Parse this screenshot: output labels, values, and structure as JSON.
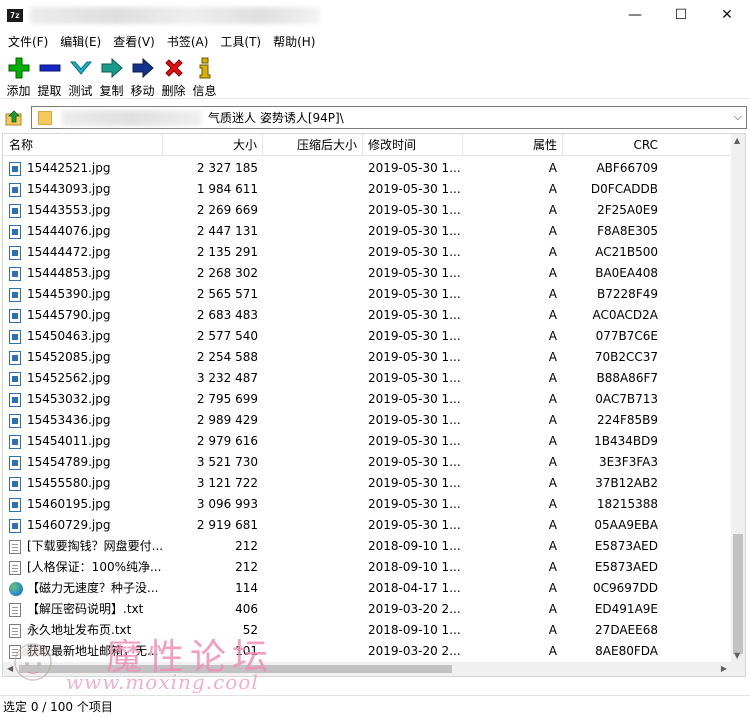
{
  "app": {
    "icon_text": "7z"
  },
  "window": {
    "minimize": "—",
    "maximize": "☐",
    "close": "✕"
  },
  "menu": [
    "文件(F)",
    "编辑(E)",
    "查看(V)",
    "书签(A)",
    "工具(T)",
    "帮助(H)"
  ],
  "toolbar": [
    {
      "label": "添加",
      "icon": "add-icon",
      "color": "#00b000"
    },
    {
      "label": "提取",
      "icon": "extract-icon",
      "color": "#1428c8"
    },
    {
      "label": "测试",
      "icon": "test-icon",
      "color": "#1ab4c8"
    },
    {
      "label": "复制",
      "icon": "copy-icon",
      "color": "#1a9c8c"
    },
    {
      "label": "移动",
      "icon": "move-icon",
      "color": "#14328c"
    },
    {
      "label": "删除",
      "icon": "delete-icon",
      "color": "#e01010"
    },
    {
      "label": "信息",
      "icon": "info-icon",
      "color": "#d8b000"
    }
  ],
  "address": {
    "path_visible": "气质迷人 姿势诱人[94P]\\"
  },
  "columns": {
    "name": "名称",
    "size": "大小",
    "packed": "压缩后大小",
    "mtime": "修改时间",
    "attr": "属性",
    "crc": "CRC"
  },
  "files": [
    {
      "name": "15442521.jpg",
      "size": "2 327 185",
      "packed": "",
      "mtime": "2019-05-30 1...",
      "attr": "A",
      "crc": "ABF66709",
      "type": "image"
    },
    {
      "name": "15443093.jpg",
      "size": "1 984 611",
      "packed": "",
      "mtime": "2019-05-30 1...",
      "attr": "A",
      "crc": "D0FCADDB",
      "type": "image"
    },
    {
      "name": "15443553.jpg",
      "size": "2 269 669",
      "packed": "",
      "mtime": "2019-05-30 1...",
      "attr": "A",
      "crc": "2F25A0E9",
      "type": "image"
    },
    {
      "name": "15444076.jpg",
      "size": "2 447 131",
      "packed": "",
      "mtime": "2019-05-30 1...",
      "attr": "A",
      "crc": "F8A8E305",
      "type": "image"
    },
    {
      "name": "15444472.jpg",
      "size": "2 135 291",
      "packed": "",
      "mtime": "2019-05-30 1...",
      "attr": "A",
      "crc": "AC21B500",
      "type": "image"
    },
    {
      "name": "15444853.jpg",
      "size": "2 268 302",
      "packed": "",
      "mtime": "2019-05-30 1...",
      "attr": "A",
      "crc": "BA0EA408",
      "type": "image"
    },
    {
      "name": "15445390.jpg",
      "size": "2 565 571",
      "packed": "",
      "mtime": "2019-05-30 1...",
      "attr": "A",
      "crc": "B7228F49",
      "type": "image"
    },
    {
      "name": "15445790.jpg",
      "size": "2 683 483",
      "packed": "",
      "mtime": "2019-05-30 1...",
      "attr": "A",
      "crc": "AC0ACD2A",
      "type": "image"
    },
    {
      "name": "15450463.jpg",
      "size": "2 577 540",
      "packed": "",
      "mtime": "2019-05-30 1...",
      "attr": "A",
      "crc": "077B7C6E",
      "type": "image"
    },
    {
      "name": "15452085.jpg",
      "size": "2 254 588",
      "packed": "",
      "mtime": "2019-05-30 1...",
      "attr": "A",
      "crc": "70B2CC37",
      "type": "image"
    },
    {
      "name": "15452562.jpg",
      "size": "3 232 487",
      "packed": "",
      "mtime": "2019-05-30 1...",
      "attr": "A",
      "crc": "B88A86F7",
      "type": "image"
    },
    {
      "name": "15453032.jpg",
      "size": "2 795 699",
      "packed": "",
      "mtime": "2019-05-30 1...",
      "attr": "A",
      "crc": "0AC7B713",
      "type": "image"
    },
    {
      "name": "15453436.jpg",
      "size": "2 989 429",
      "packed": "",
      "mtime": "2019-05-30 1...",
      "attr": "A",
      "crc": "224F85B9",
      "type": "image"
    },
    {
      "name": "15454011.jpg",
      "size": "2 979 616",
      "packed": "",
      "mtime": "2019-05-30 1...",
      "attr": "A",
      "crc": "1B434BD9",
      "type": "image"
    },
    {
      "name": "15454789.jpg",
      "size": "3 521 730",
      "packed": "",
      "mtime": "2019-05-30 1...",
      "attr": "A",
      "crc": "3E3F3FA3",
      "type": "image"
    },
    {
      "name": "15455580.jpg",
      "size": "3 121 722",
      "packed": "",
      "mtime": "2019-05-30 1...",
      "attr": "A",
      "crc": "37B12AB2",
      "type": "image"
    },
    {
      "name": "15460195.jpg",
      "size": "3 096 993",
      "packed": "",
      "mtime": "2019-05-30 1...",
      "attr": "A",
      "crc": "18215388",
      "type": "image"
    },
    {
      "name": "15460729.jpg",
      "size": "2 919 681",
      "packed": "",
      "mtime": "2019-05-30 1...",
      "attr": "A",
      "crc": "05AA9EBA",
      "type": "image"
    },
    {
      "name": "[下载要掏钱？网盘要付...",
      "size": "212",
      "packed": "",
      "mtime": "2018-09-10 1...",
      "attr": "A",
      "crc": "E5873AED",
      "type": "text"
    },
    {
      "name": "[人格保证：100%纯净...",
      "size": "212",
      "packed": "",
      "mtime": "2018-09-10 1...",
      "attr": "A",
      "crc": "E5873AED",
      "type": "text"
    },
    {
      "name": "【磁力无速度？种子没...",
      "size": "114",
      "packed": "",
      "mtime": "2018-04-17 1...",
      "attr": "A",
      "crc": "0C9697DD",
      "type": "url"
    },
    {
      "name": "【解压密码说明】.txt",
      "size": "406",
      "packed": "",
      "mtime": "2019-03-20 2...",
      "attr": "A",
      "crc": "ED491A9E",
      "type": "text"
    },
    {
      "name": "永久地址发布页.txt",
      "size": "52",
      "packed": "",
      "mtime": "2018-09-10 1...",
      "attr": "A",
      "crc": "27DAEE68",
      "type": "text"
    },
    {
      "name": "获取最新地址邮箱，无...",
      "size": "101",
      "packed": "",
      "mtime": "2019-03-20 2...",
      "attr": "A",
      "crc": "8AE80FDA",
      "type": "text"
    }
  ],
  "status": {
    "text": "选定 0 / 100 个项目"
  },
  "watermark": {
    "title": "魔性论坛",
    "url": "www.moxing.cool"
  }
}
